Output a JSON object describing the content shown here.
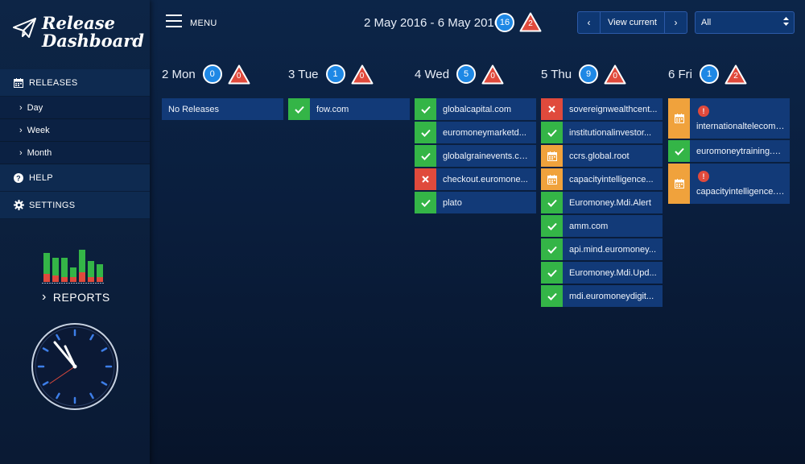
{
  "brand": {
    "line1": "Release",
    "line2": "Dashboard"
  },
  "nav": {
    "releases": "RELEASES",
    "sub": [
      "Day",
      "Week",
      "Month"
    ],
    "help": "HELP",
    "settings": "SETTINGS"
  },
  "reports": {
    "label": "REPORTS"
  },
  "topbar": {
    "menu_label": "MENU",
    "date_range": "2 May 2016 - 6 May 2016",
    "total_count": "16",
    "total_failed": "2",
    "view_current": "View current",
    "filter_value": "All"
  },
  "colors": {
    "ok": "#34b547",
    "fail": "#e04a3c",
    "pending": "#f0a23c",
    "badge_blue": "#1e88e5"
  },
  "days": [
    {
      "label": "2 Mon",
      "count": "0",
      "failed": "0",
      "releases": [
        {
          "status": "none",
          "name": "No Releases"
        }
      ]
    },
    {
      "label": "3 Tue",
      "count": "1",
      "failed": "0",
      "releases": [
        {
          "status": "ok",
          "name": "fow.com"
        }
      ]
    },
    {
      "label": "4 Wed",
      "count": "5",
      "failed": "0",
      "releases": [
        {
          "status": "ok",
          "name": "globalcapital.com"
        },
        {
          "status": "ok",
          "name": "euromoneymarketd..."
        },
        {
          "status": "ok",
          "name": "globalgrainevents.co..."
        },
        {
          "status": "fail",
          "name": "checkout.euromone..."
        },
        {
          "status": "ok",
          "name": "plato"
        }
      ]
    },
    {
      "label": "5 Thu",
      "count": "9",
      "failed": "0",
      "releases": [
        {
          "status": "fail",
          "name": "sovereignwealthcent..."
        },
        {
          "status": "ok",
          "name": "institutionalinvestor..."
        },
        {
          "status": "pending",
          "name": "ccrs.global.root"
        },
        {
          "status": "pending",
          "name": "capacityintelligence..."
        },
        {
          "status": "ok",
          "name": "Euromoney.Mdi.Alert"
        },
        {
          "status": "ok",
          "name": "amm.com"
        },
        {
          "status": "ok",
          "name": "api.mind.euromoney..."
        },
        {
          "status": "ok",
          "name": "Euromoney.Mdi.Upd..."
        },
        {
          "status": "ok",
          "name": "mdi.euromoneydigit..."
        }
      ]
    },
    {
      "label": "6 Fri",
      "count": "1",
      "failed": "2",
      "releases": [
        {
          "status": "pending",
          "warn": true,
          "name": "internationaltelecoms..."
        },
        {
          "status": "ok",
          "name": "euromoneytraining.co..."
        },
        {
          "status": "pending",
          "warn": true,
          "name": "capacityintelligence.c..."
        }
      ]
    }
  ]
}
